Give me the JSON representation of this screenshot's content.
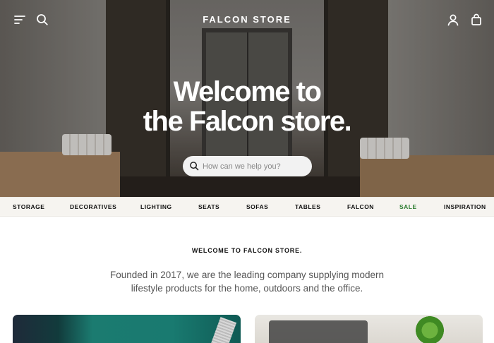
{
  "header": {
    "brand": "FALCON STORE",
    "icons": [
      "menu-icon",
      "search-icon",
      "user-icon",
      "bag-icon"
    ]
  },
  "hero": {
    "headline_line1": "Welcome to",
    "headline_line2": "the Falcon store.",
    "search_placeholder": "How can we help you?",
    "search_value": ""
  },
  "categories": [
    {
      "label": "STORAGE"
    },
    {
      "label": "DECORATIVES"
    },
    {
      "label": "LIGHTING"
    },
    {
      "label": "SEATS"
    },
    {
      "label": "SOFAS"
    },
    {
      "label": "TABLES"
    },
    {
      "label": "FALCON"
    },
    {
      "label": "SALE"
    },
    {
      "label": "INSPIRATION"
    }
  ],
  "intro": {
    "title": "WELCOME TO FALCON STORE.",
    "text": "Founded in 2017, we are the leading company supplying modern lifestyle products for the home, outdoors and the office."
  },
  "colors": {
    "sale": "#2e7d32",
    "nav_bg": "#f6f4f0",
    "text_primary": "#111111",
    "text_secondary": "#555555"
  }
}
